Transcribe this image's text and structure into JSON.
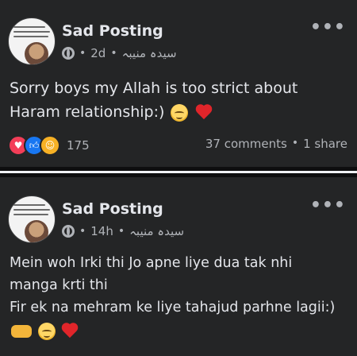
{
  "posts": [
    {
      "page_name": "Sad Posting",
      "time": "2d",
      "author": "سیدہ منیبہ",
      "text": "Sorry boys my Allah is too strict about Haram relationship:)",
      "emoji_icons": [
        "relieved-face-icon",
        "red-heart-icon"
      ],
      "reactions": {
        "icons": [
          "love-reaction-icon",
          "like-reaction-icon",
          "care-reaction-icon"
        ],
        "count": "175"
      },
      "comments": "37 comments",
      "shares": "1 share"
    },
    {
      "page_name": "Sad Posting",
      "time": "14h",
      "author": "سیدہ منیبہ",
      "lines": [
        "Mein woh Irki thi Jo apne liye dua tak nhi",
        "manga krti thi",
        "Fir ek na mehram ke liye tahajud parhne lagii:)"
      ],
      "emoji_icons": [
        "handshake-icon",
        "relieved-face-icon",
        "red-heart-icon"
      ]
    }
  ],
  "colors": {
    "background": "#18191a",
    "card": "#242526",
    "text": "#e4e6eb",
    "muted": "#b0b3b8",
    "love": "#f33e58",
    "like": "#1877f2",
    "care": "#f7b125"
  }
}
